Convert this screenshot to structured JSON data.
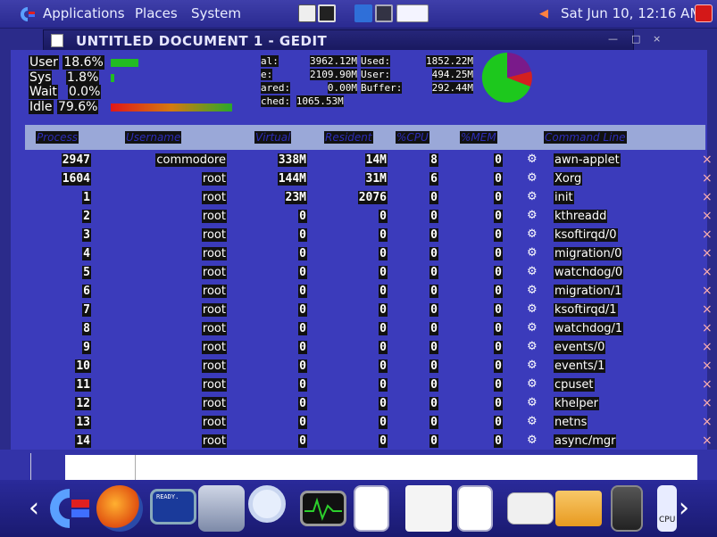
{
  "top_panel": {
    "applications": "Applications",
    "places": "Places",
    "system": "System",
    "clock": "Sat Jun 10, 12:16 AM"
  },
  "window_title": "UNTITLED DOCUMENT 1 - GEDIT",
  "cpu": {
    "user_label": "User",
    "user_value": "18.6%",
    "user_fraction": 0.186,
    "sys_label": "Sys",
    "sys_value": "1.8%",
    "sys_fraction": 0.018,
    "wait_label": "Wait",
    "wait_value": "0.0%",
    "idle_label": "Idle",
    "idle_value": "79.6%",
    "idle_fraction": 0.796
  },
  "memory": {
    "total_label": "al:",
    "total_value": "3962.12M",
    "free_label": "e:",
    "free_value": "2109.90M",
    "shared_label": "ared:",
    "shared_value": "0.00M",
    "cached_label": "ched:",
    "cached_value": "1065.53M",
    "used_label": "Used:",
    "used_value": "1852.22M",
    "user_label": "User:",
    "user_value": "494.25M",
    "buffer_label": "Buffer:",
    "buffer_value": "292.44M"
  },
  "pie_colors": {
    "green": "#1dc81d",
    "red": "#d42020",
    "purple": "#7a1a8a"
  },
  "columns": [
    "Process",
    "Username",
    "Virtual",
    "Resident",
    "%CPU",
    "%MEM",
    "Command Line"
  ],
  "processes": [
    {
      "pid": "2947",
      "user": "commodore",
      "virt": "338M",
      "res": "14M",
      "cpu": "8",
      "mem": "0",
      "cmd": "awn-applet"
    },
    {
      "pid": "1604",
      "user": "root",
      "virt": "144M",
      "res": "31M",
      "cpu": "6",
      "mem": "0",
      "cmd": "Xorg"
    },
    {
      "pid": "1",
      "user": "root",
      "virt": "23M",
      "res": "2076",
      "cpu": "0",
      "mem": "0",
      "cmd": "init"
    },
    {
      "pid": "2",
      "user": "root",
      "virt": "0",
      "res": "0",
      "cpu": "0",
      "mem": "0",
      "cmd": "kthreadd"
    },
    {
      "pid": "3",
      "user": "root",
      "virt": "0",
      "res": "0",
      "cpu": "0",
      "mem": "0",
      "cmd": "ksoftirqd/0"
    },
    {
      "pid": "4",
      "user": "root",
      "virt": "0",
      "res": "0",
      "cpu": "0",
      "mem": "0",
      "cmd": "migration/0"
    },
    {
      "pid": "5",
      "user": "root",
      "virt": "0",
      "res": "0",
      "cpu": "0",
      "mem": "0",
      "cmd": "watchdog/0"
    },
    {
      "pid": "6",
      "user": "root",
      "virt": "0",
      "res": "0",
      "cpu": "0",
      "mem": "0",
      "cmd": "migration/1"
    },
    {
      "pid": "7",
      "user": "root",
      "virt": "0",
      "res": "0",
      "cpu": "0",
      "mem": "0",
      "cmd": "ksoftirqd/1"
    },
    {
      "pid": "8",
      "user": "root",
      "virt": "0",
      "res": "0",
      "cpu": "0",
      "mem": "0",
      "cmd": "watchdog/1"
    },
    {
      "pid": "9",
      "user": "root",
      "virt": "0",
      "res": "0",
      "cpu": "0",
      "mem": "0",
      "cmd": "events/0"
    },
    {
      "pid": "10",
      "user": "root",
      "virt": "0",
      "res": "0",
      "cpu": "0",
      "mem": "0",
      "cmd": "events/1"
    },
    {
      "pid": "11",
      "user": "root",
      "virt": "0",
      "res": "0",
      "cpu": "0",
      "mem": "0",
      "cmd": "cpuset"
    },
    {
      "pid": "12",
      "user": "root",
      "virt": "0",
      "res": "0",
      "cpu": "0",
      "mem": "0",
      "cmd": "khelper"
    },
    {
      "pid": "13",
      "user": "root",
      "virt": "0",
      "res": "0",
      "cpu": "0",
      "mem": "0",
      "cmd": "netns"
    },
    {
      "pid": "14",
      "user": "root",
      "virt": "0",
      "res": "0",
      "cpu": "0",
      "mem": "0",
      "cmd": "async/mgr"
    }
  ],
  "dock_icons": [
    "commodore-logo-icon",
    "firefox-icon",
    "terminal-ready-icon",
    "system-settings-icon",
    "search-icon",
    "system-monitor-icon",
    "document-viewer-icon",
    "text-editor-icon",
    "document-icon",
    "mail-lock-icon",
    "folder-icon",
    "speaker-icon",
    "cpu-icon"
  ],
  "dock_cpu_label": "CPU"
}
